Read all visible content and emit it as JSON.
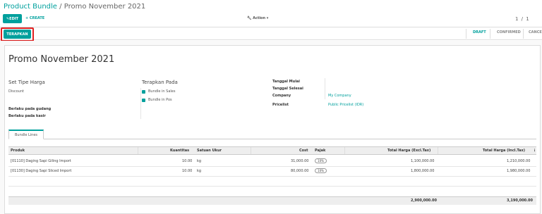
{
  "breadcrumb": {
    "parent": "Product Bundle",
    "separator": "/",
    "current": "Promo November 2021"
  },
  "toolbar": {
    "edit_label": "EDIT",
    "create_label": "+ CREATE",
    "action_label": "Action",
    "pager": "1 / 1"
  },
  "statusbar": {
    "apply_label": "TERAPKAN",
    "stages": [
      "DRAFT",
      "CONFIRMED",
      "CANCE"
    ],
    "active_stage": "DRAFT"
  },
  "form": {
    "title": "Promo November 2021",
    "set_tipe_harga": {
      "label": "Set Tipe Harga",
      "value": "Discount"
    },
    "berlaku_gudang_label": "Berlaku pada gudang",
    "berlaku_kasir_label": "Berlaku pada kasir",
    "terapkan_pada": {
      "label": "Terapkan Pada",
      "options": [
        "Bundle in Sales",
        "Bundle in Pos"
      ]
    },
    "tanggal_mulai_label": "Tanggal Mulai",
    "tanggal_selesai_label": "Tanggal Selesai",
    "company": {
      "label": "Company",
      "value": "My Company"
    },
    "pricelist": {
      "label": "Pricelist",
      "value": "Public Pricelist (IDR)"
    }
  },
  "tabs": {
    "bundle_lines": "Bundle Lines"
  },
  "table": {
    "columns": [
      "Produk",
      "Kuantitas",
      "Satuan Ukur",
      "Cost",
      "Pajak",
      "Total Harga (Excl.Tax)",
      "Total Harga (Incl.Tax)"
    ],
    "rows": [
      {
        "produk": "[01110] Daging Sapi Giling Import",
        "qty": "10.00",
        "uom": "kg",
        "cost": "31,000.00",
        "tax": "10%",
        "excl": "1,100,000.00",
        "incl": "1,210,000.00"
      },
      {
        "produk": "[01130] Daging Sapi Sliced Import",
        "qty": "10.00",
        "uom": "kg",
        "cost": "80,000.00",
        "tax": "10%",
        "excl": "1,800,000.00",
        "incl": "1,980,000.00"
      }
    ],
    "totals": {
      "excl": "2,900,000.00",
      "incl": "3,190,000.00"
    }
  },
  "colors": {
    "accent": "#00a09d",
    "highlight": "#e02020"
  }
}
